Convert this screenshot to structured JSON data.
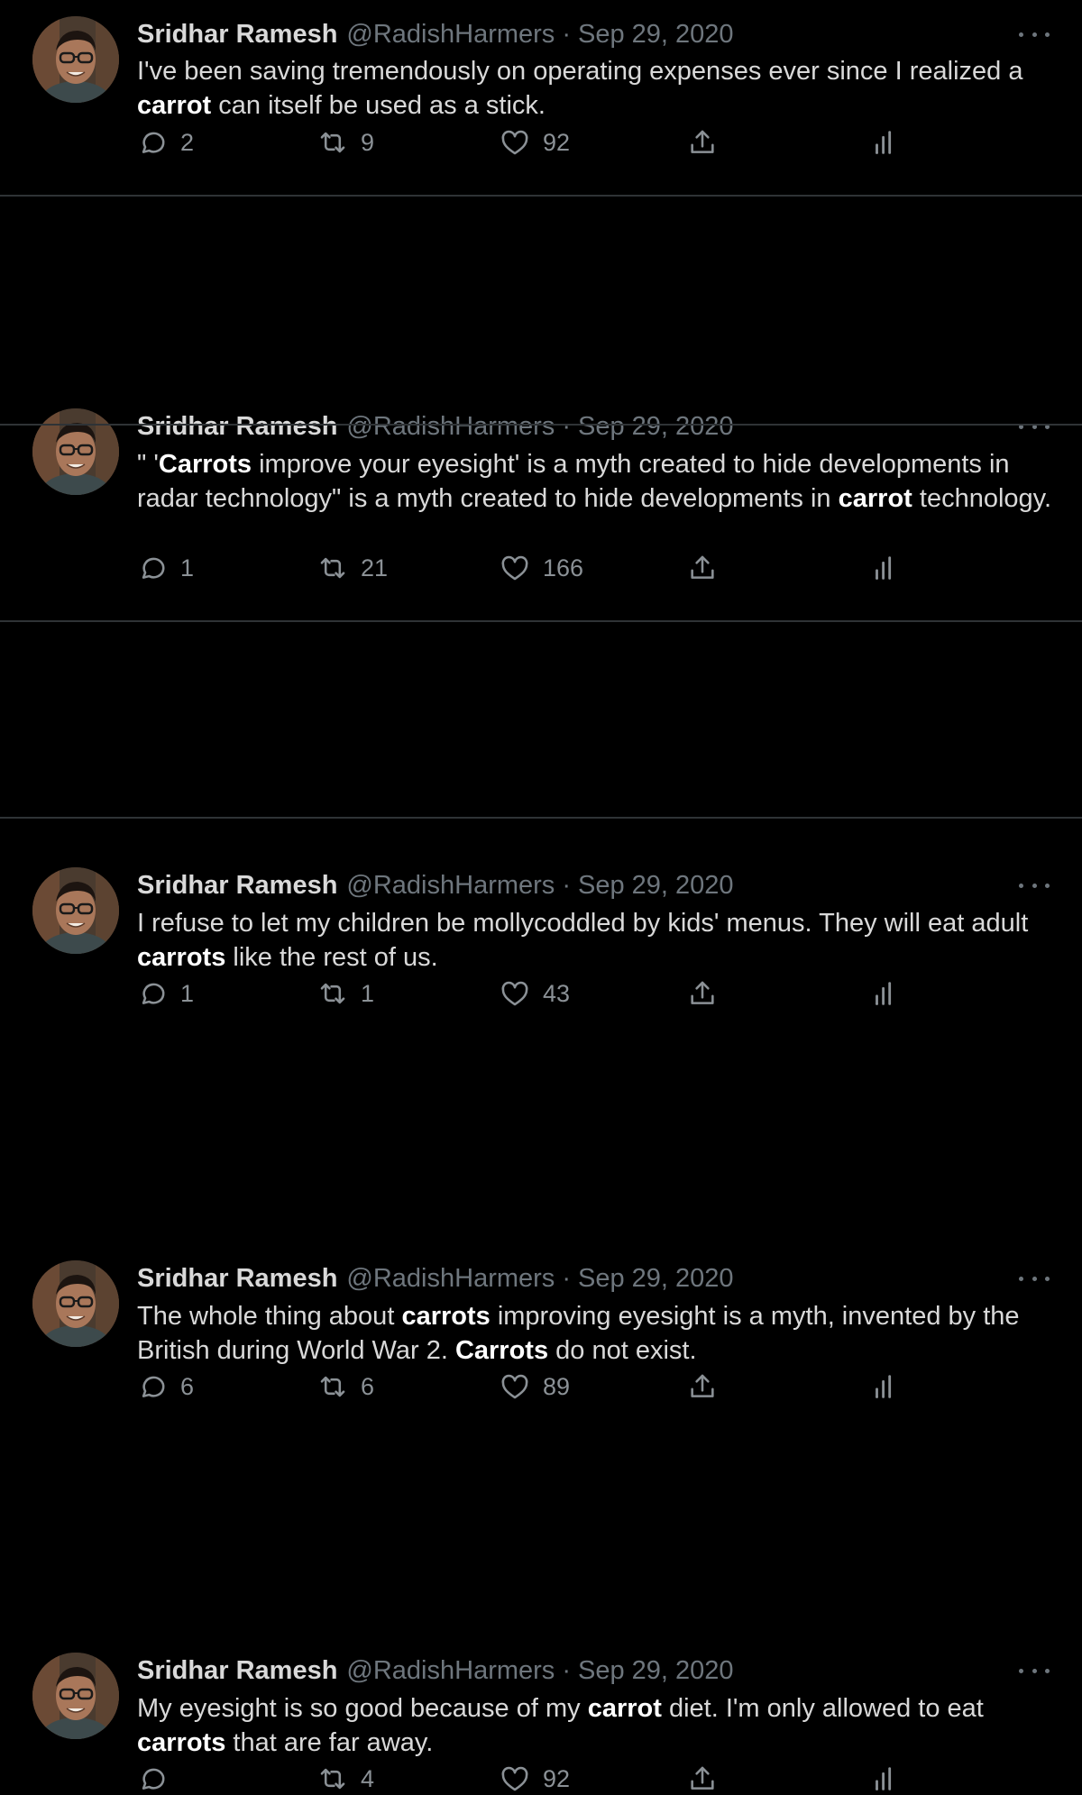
{
  "tweets": [
    {
      "name": "Sridhar Ramesh",
      "handle": "@RadishHarmers",
      "separator": "·",
      "date": "Sep 29, 2020",
      "text_segments": [
        {
          "t": "I've been saving tremendously on operating expenses ever since I realized a ",
          "b": false
        },
        {
          "t": "carrot",
          "b": true
        },
        {
          "t": " can itself be used as a stick.",
          "b": false
        }
      ],
      "replies": "2",
      "retweets": "9",
      "likes": "92"
    },
    {
      "name": "Sridhar Ramesh",
      "handle": "@RadishHarmers",
      "separator": "·",
      "date": "Sep 29, 2020",
      "text_segments": [
        {
          "t": "\" '",
          "b": false
        },
        {
          "t": "Carrots",
          "b": true
        },
        {
          "t": " improve your eyesight' is a myth created to hide developments in radar technology\" is a myth created to hide developments in ",
          "b": false
        },
        {
          "t": "carrot",
          "b": true
        },
        {
          "t": " technology.",
          "b": false
        }
      ],
      "replies": "1",
      "retweets": "21",
      "likes": "166"
    },
    {
      "name": "Sridhar Ramesh",
      "handle": "@RadishHarmers",
      "separator": "·",
      "date": "Sep 29, 2020",
      "text_segments": [
        {
          "t": "I refuse to let my children be mollycoddled by kids' menus. They will eat adult ",
          "b": false
        },
        {
          "t": "carrots",
          "b": true
        },
        {
          "t": " like the rest of us.",
          "b": false
        }
      ],
      "replies": "1",
      "retweets": "1",
      "likes": "43"
    },
    {
      "name": "Sridhar Ramesh",
      "handle": "@RadishHarmers",
      "separator": "·",
      "date": "Sep 29, 2020",
      "text_segments": [
        {
          "t": "The whole thing about ",
          "b": false
        },
        {
          "t": "carrots",
          "b": true
        },
        {
          "t": " improving eyesight is a myth, invented by the British during World War 2. ",
          "b": false
        },
        {
          "t": "Carrots",
          "b": true
        },
        {
          "t": " do not exist.",
          "b": false
        }
      ],
      "replies": "6",
      "retweets": "6",
      "likes": "89"
    },
    {
      "name": "Sridhar Ramesh",
      "handle": "@RadishHarmers",
      "separator": "·",
      "date": "Sep 29, 2020",
      "text_segments": [
        {
          "t": "My eyesight is so good because of my ",
          "b": false
        },
        {
          "t": "carrot",
          "b": true
        },
        {
          "t": " diet. I'm only allowed to eat ",
          "b": false
        },
        {
          "t": "carrots",
          "b": true
        },
        {
          "t": " that are far away.",
          "b": false
        }
      ],
      "replies": "",
      "retweets": "4",
      "likes": "92"
    }
  ],
  "icons": {
    "reply": "speech-bubble",
    "retweet": "retweet-arrows",
    "like": "heart",
    "share": "upload-arrow",
    "analytics": "bar-chart",
    "more": "three-dots"
  },
  "colors": {
    "background": "#000000",
    "text": "#d9d9d9",
    "bold_text": "#ffffff",
    "muted": "#6e767d",
    "divider": "#2f3336"
  }
}
